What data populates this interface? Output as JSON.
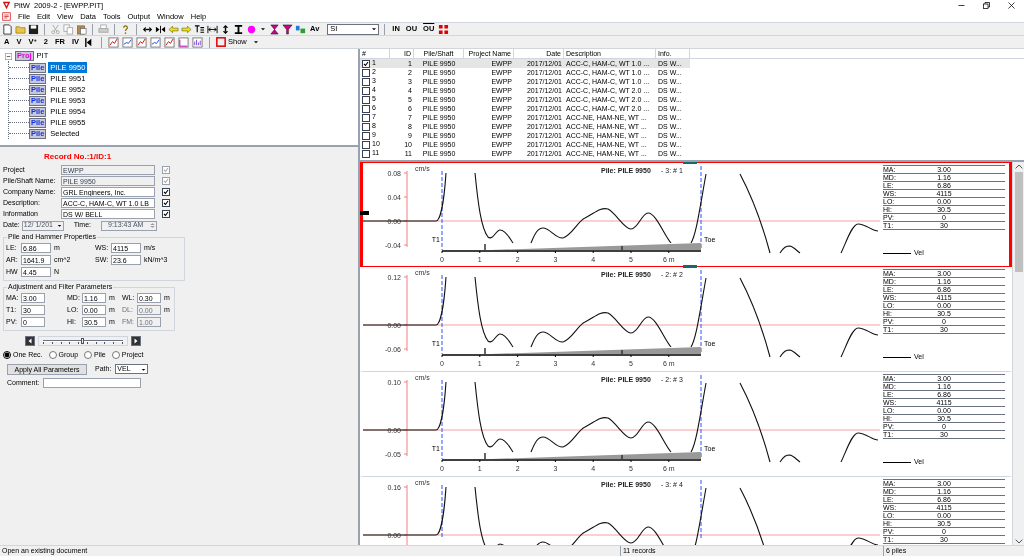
{
  "window": {
    "title": "PitW  2009-2 - [EWPP.PIT]"
  },
  "menu": [
    "File",
    "Edit",
    "View",
    "Data",
    "Tools",
    "Output",
    "Window",
    "Help"
  ],
  "toolbar_1": {
    "text_button": "Av",
    "units": "SI",
    "mode_buttons": [
      {
        "label": "IN",
        "kind": "plain"
      },
      {
        "label": "OU",
        "kind": "plain"
      },
      {
        "label": "OU",
        "kind": "overline"
      }
    ]
  },
  "toolbar_2": {
    "buttons": [
      "A",
      "V",
      "V$^{+}$",
      "2",
      "FR",
      "IV"
    ],
    "show": "Show"
  },
  "tree": {
    "label": "PIT",
    "badge": "Proj",
    "expanded": true,
    "children": [
      {
        "label": "PILE 9950",
        "badge": "Pile",
        "selected": true
      },
      {
        "label": "PILE 9951",
        "badge": "Pile",
        "selected": false
      },
      {
        "label": "PILE 9952",
        "badge": "Pile",
        "selected": false
      },
      {
        "label": "PILE 9953",
        "badge": "Pile",
        "selected": false
      },
      {
        "label": "PILE 9954",
        "badge": "Pile",
        "selected": false
      },
      {
        "label": "PILE 9955",
        "badge": "Pile",
        "selected": false
      },
      {
        "label": "Selected",
        "badge": "Pile",
        "selected": false
      }
    ]
  },
  "record_form": {
    "heading": "Record No.:1/ID:1",
    "fields": [
      {
        "label": "Project",
        "value": "EWPP",
        "checked": true,
        "disabled": true
      },
      {
        "label": "Pile/Shaft Name:",
        "value": "PILE 9950",
        "checked": true,
        "disabled": true
      },
      {
        "label": "Company Name:",
        "value": "GRL Engineers, Inc.",
        "checked": true,
        "disabled": false
      },
      {
        "label": "Description:",
        "value": "ACC-C, HAM-C, WT 1.0 LB",
        "checked": true,
        "disabled": false
      },
      {
        "label": "Information",
        "value": "DS W/ BELL",
        "checked": true,
        "disabled": false
      }
    ],
    "date": {
      "label": "Date:",
      "value": "12/ 1/201"
    },
    "time": {
      "label": "Time:",
      "value": "9:13:43 AM"
    },
    "pile_properties": {
      "title": "Pile and Hammer Properties",
      "params": [
        {
          "label": "LE:",
          "value": "6.86",
          "unit": "m"
        },
        {
          "label": "WS:",
          "value": "4115",
          "unit": "m/s"
        },
        {
          "label": "AR:",
          "value": "1641.9",
          "unit": "cm^2"
        },
        {
          "label": "SW:",
          "value": "23.6",
          "unit": "kN/m^3"
        },
        {
          "label": "HW",
          "value": "4.45",
          "unit": "N"
        }
      ]
    },
    "filter_parameters": {
      "title": "Adjustment and Filter Parameters",
      "params": [
        {
          "label": "MA:",
          "value": "3.00",
          "disabled": false
        },
        {
          "label": "MD:",
          "value": "1.16",
          "unit": "m",
          "disabled": false
        },
        {
          "label": "WL:",
          "value": "0.30",
          "unit": "m",
          "disabled": false
        },
        {
          "label": "T1:",
          "value": "30",
          "disabled": false
        },
        {
          "label": "LO:",
          "value": "0.00",
          "unit": "m",
          "disabled": false
        },
        {
          "label": "DL:",
          "value": "0.00",
          "unit": "m",
          "disabled": true
        },
        {
          "label": "PV:",
          "value": "0",
          "disabled": false
        },
        {
          "label": "HI:",
          "value": "30.5",
          "unit": "m",
          "disabled": false
        },
        {
          "label": "FM:",
          "value": "1.00",
          "disabled": true
        }
      ]
    },
    "slider": {
      "level": 0.5
    },
    "scope": [
      {
        "label": "One Rec.",
        "selected": true
      },
      {
        "label": "Group",
        "selected": false
      },
      {
        "label": "Pile",
        "selected": false
      },
      {
        "label": "Project",
        "selected": false
      }
    ],
    "apply_button": "Apply All Parameters",
    "path": {
      "label": "Path:",
      "value": "VEL"
    },
    "comment": {
      "label": "Comment:"
    }
  },
  "table": {
    "columns": [
      "#",
      "ID",
      "Pile/Shaft",
      "Project Name",
      "Date",
      "Description",
      "Info."
    ],
    "rows": [
      {
        "checked": true,
        "selected": true,
        "cells": [
          "1",
          "1",
          "PILE 9950",
          "EWPP",
          "2017/12/01",
          "ACC-C, HAM-C, WT 1.0 ...",
          "DS W..."
        ]
      },
      {
        "checked": false,
        "selected": false,
        "cells": [
          "2",
          "2",
          "PILE 9950",
          "EWPP",
          "2017/12/01",
          "ACC-C, HAM-C, WT 1.0 ...",
          "DS W..."
        ]
      },
      {
        "checked": false,
        "selected": false,
        "cells": [
          "3",
          "3",
          "PILE 9950",
          "EWPP",
          "2017/12/01",
          "ACC-C, HAM-C, WT 1.0 ...",
          "DS W..."
        ]
      },
      {
        "checked": false,
        "selected": false,
        "cells": [
          "4",
          "4",
          "PILE 9950",
          "EWPP",
          "2017/12/01",
          "ACC-C, HAM-C, WT 2.0 ...",
          "DS W..."
        ]
      },
      {
        "checked": false,
        "selected": false,
        "cells": [
          "5",
          "5",
          "PILE 9950",
          "EWPP",
          "2017/12/01",
          "ACC-C, HAM-C, WT 2.0 ...",
          "DS W..."
        ]
      },
      {
        "checked": false,
        "selected": false,
        "cells": [
          "6",
          "6",
          "PILE 9950",
          "EWPP",
          "2017/12/01",
          "ACC-C, HAM-C, WT 2.0 ...",
          "DS W..."
        ]
      },
      {
        "checked": false,
        "selected": false,
        "cells": [
          "7",
          "7",
          "PILE 9950",
          "EWPP",
          "2017/12/01",
          "ACC-NE, HAM-NE, WT ...",
          "DS W..."
        ]
      },
      {
        "checked": false,
        "selected": false,
        "cells": [
          "8",
          "8",
          "PILE 9950",
          "EWPP",
          "2017/12/01",
          "ACC-NE, HAM-NE, WT ...",
          "DS W..."
        ]
      },
      {
        "checked": false,
        "selected": false,
        "cells": [
          "9",
          "9",
          "PILE 9950",
          "EWPP",
          "2017/12/01",
          "ACC-NE, HAM-NE, WT ...",
          "DS W..."
        ]
      },
      {
        "checked": false,
        "selected": false,
        "cells": [
          "10",
          "10",
          "PILE 9950",
          "EWPP",
          "2017/12/01",
          "ACC-NE, HAM-NE, WT ...",
          "DS W..."
        ]
      },
      {
        "checked": false,
        "selected": false,
        "cells": [
          "11",
          "11",
          "PILE 9950",
          "EWPP",
          "2017/12/01",
          "ACC-NE, HAM-NE, WT ...",
          "DS W..."
        ]
      }
    ]
  },
  "waveforms": [
    {
      "title": "Pile: PILE 9950",
      "record": "- 3: # 1",
      "selected": true,
      "y_unit": "cm/s",
      "y_ticks": [
        "0.08",
        "0.04",
        "0.00",
        "-0.04"
      ],
      "x_ticks": [
        "0",
        "1",
        "2",
        "3",
        "4",
        "5",
        "6 m"
      ],
      "markers": [
        "T1",
        "Toe"
      ],
      "legend": "Vel",
      "stats": [
        {
          "label": "MA:",
          "value": "3.00"
        },
        {
          "label": "MD:",
          "value": "1.16"
        },
        {
          "label": "LE:",
          "value": "6.86"
        },
        {
          "label": "WS:",
          "value": "4115"
        },
        {
          "label": "LO:",
          "value": "0.00"
        },
        {
          "label": "HI:",
          "value": "30.5"
        },
        {
          "label": "PV:",
          "value": "0"
        },
        {
          "label": "T1:",
          "value": "30"
        }
      ]
    },
    {
      "title": "Pile: PILE 9950",
      "record": "- 2: # 2",
      "selected": false,
      "y_unit": "cm/s",
      "y_ticks": [
        "0.12",
        "0.00",
        "-0.06"
      ],
      "x_ticks": [
        "0",
        "1",
        "2",
        "3",
        "4",
        "5",
        "6 m"
      ],
      "markers": [
        "T1",
        "Toe"
      ],
      "legend": "Vel",
      "stats": [
        {
          "label": "MA:",
          "value": "3.00"
        },
        {
          "label": "MD:",
          "value": "1.16"
        },
        {
          "label": "LE:",
          "value": "6.86"
        },
        {
          "label": "WS:",
          "value": "4115"
        },
        {
          "label": "LO:",
          "value": "0.00"
        },
        {
          "label": "HI:",
          "value": "30.5"
        },
        {
          "label": "PV:",
          "value": "0"
        },
        {
          "label": "T1:",
          "value": "30"
        }
      ]
    },
    {
      "title": "Pile: PILE 9950",
      "record": "- 2: # 3",
      "selected": false,
      "y_unit": "cm/s",
      "y_ticks": [
        "0.10",
        "0.00",
        "-0.05"
      ],
      "x_ticks": [
        "0",
        "1",
        "2",
        "3",
        "4",
        "5",
        "6 m"
      ],
      "markers": [
        "T1",
        "Toe"
      ],
      "legend": "Vel",
      "stats": [
        {
          "label": "MA:",
          "value": "3.00"
        },
        {
          "label": "MD:",
          "value": "1.16"
        },
        {
          "label": "LE:",
          "value": "6.86"
        },
        {
          "label": "WS:",
          "value": "4115"
        },
        {
          "label": "LO:",
          "value": "0.00"
        },
        {
          "label": "HI:",
          "value": "30.5"
        },
        {
          "label": "PV:",
          "value": "0"
        },
        {
          "label": "T1:",
          "value": "30"
        }
      ]
    },
    {
      "title": "Pile: PILE 9950",
      "record": "- 3: # 4",
      "selected": false,
      "y_unit": "cm/s",
      "y_ticks": [
        "0.16",
        "0.00"
      ],
      "stats": [
        {
          "label": "MA:",
          "value": "3.00"
        },
        {
          "label": "MD:",
          "value": "1.16"
        },
        {
          "label": "LE:",
          "value": "6.86"
        },
        {
          "label": "WS:",
          "value": "4115"
        },
        {
          "label": "LO:",
          "value": "0.00"
        },
        {
          "label": "HI:",
          "value": "30.5"
        },
        {
          "label": "PV:",
          "value": "0"
        },
        {
          "label": "T1:",
          "value": "30"
        }
      ]
    }
  ],
  "status_bar": [
    "Open an existing document",
    "11 records",
    "6 piles"
  ]
}
